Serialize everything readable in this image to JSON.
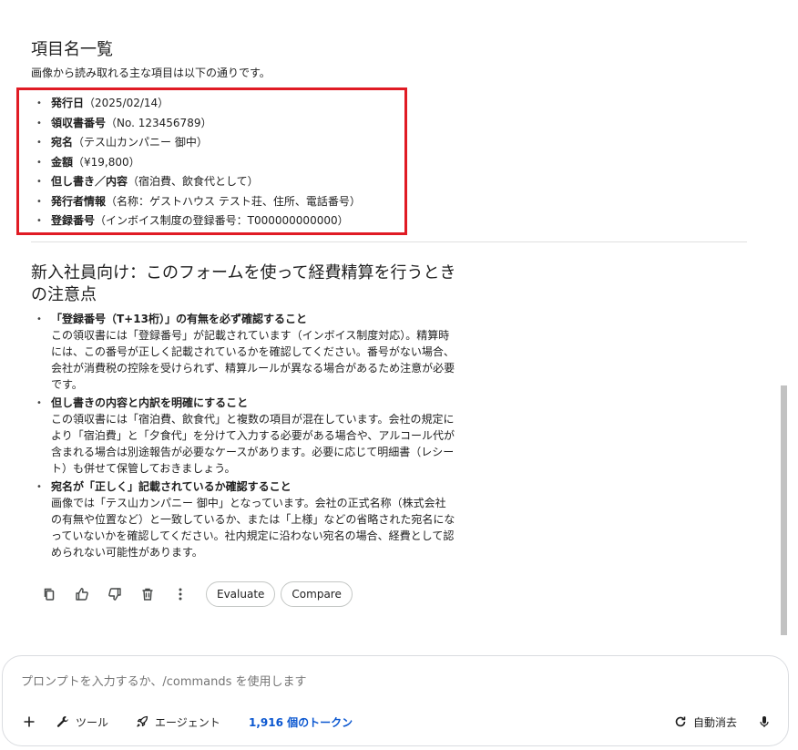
{
  "section1": {
    "title": "項目名一覧",
    "intro": "画像から読み取れる主な項目は以下の通りです。",
    "items": [
      {
        "label": "発行日",
        "detail": "（2025/02/14）"
      },
      {
        "label": "領収書番号",
        "detail": "（No. 123456789）"
      },
      {
        "label": "宛名",
        "detail": "（テス山カンパニー 御中）"
      },
      {
        "label": "金額",
        "detail": "（¥19,800）"
      },
      {
        "label": "但し書き／内容",
        "detail": "（宿泊費、飲食代として）"
      },
      {
        "label": "発行者情報",
        "detail": "（名称：ゲストハウス テスト荘、住所、電話番号）"
      },
      {
        "label": "登録番号",
        "detail": "（インボイス制度の登録番号：T000000000000）"
      }
    ]
  },
  "section2": {
    "title": "新入社員向け：このフォームを使って経費精算を行うときの注意点",
    "tips": [
      {
        "title": "「登録番号（T+13桁）」の有無を必ず確認すること",
        "text": "この領収書には「登録番号」が記載されています（インボイス制度対応）。精算時には、この番号が正しく記載されているかを確認してください。番号がない場合、会社が消費税の控除を受けられず、精算ルールが異なる場合があるため注意が必要です。"
      },
      {
        "title": "但し書きの内容と内訳を明確にすること",
        "text": "この領収書には「宿泊費、飲食代」と複数の項目が混在しています。会社の規定により「宿泊費」と「夕食代」を分けて入力する必要がある場合や、アルコール代が含まれる場合は別途報告が必要なケースがあります。必要に応じて明細書（レシート）も併せて保管しておきましょう。"
      },
      {
        "title": "宛名が「正しく」記載されているか確認すること",
        "text": "画像では「テス山カンパニー 御中」となっています。会社の正式名称（株式会社の有無や位置など）と一致しているか、または「上様」などの省略された宛名になっていないかを確認してください。社内規定に沿わない宛名の場合、経費として認められない可能性があります。"
      }
    ]
  },
  "actions": {
    "evaluate": "Evaluate",
    "compare": "Compare"
  },
  "composer": {
    "placeholder": "プロンプトを入力するか、/commands を使用します",
    "tools": "ツール",
    "agent": "エージェント",
    "tokens": "1,916 個のトークン",
    "auto_clear": "自動消去"
  },
  "colors": {
    "highlight_border": "#e01b24",
    "token_link": "#0b57d0"
  }
}
